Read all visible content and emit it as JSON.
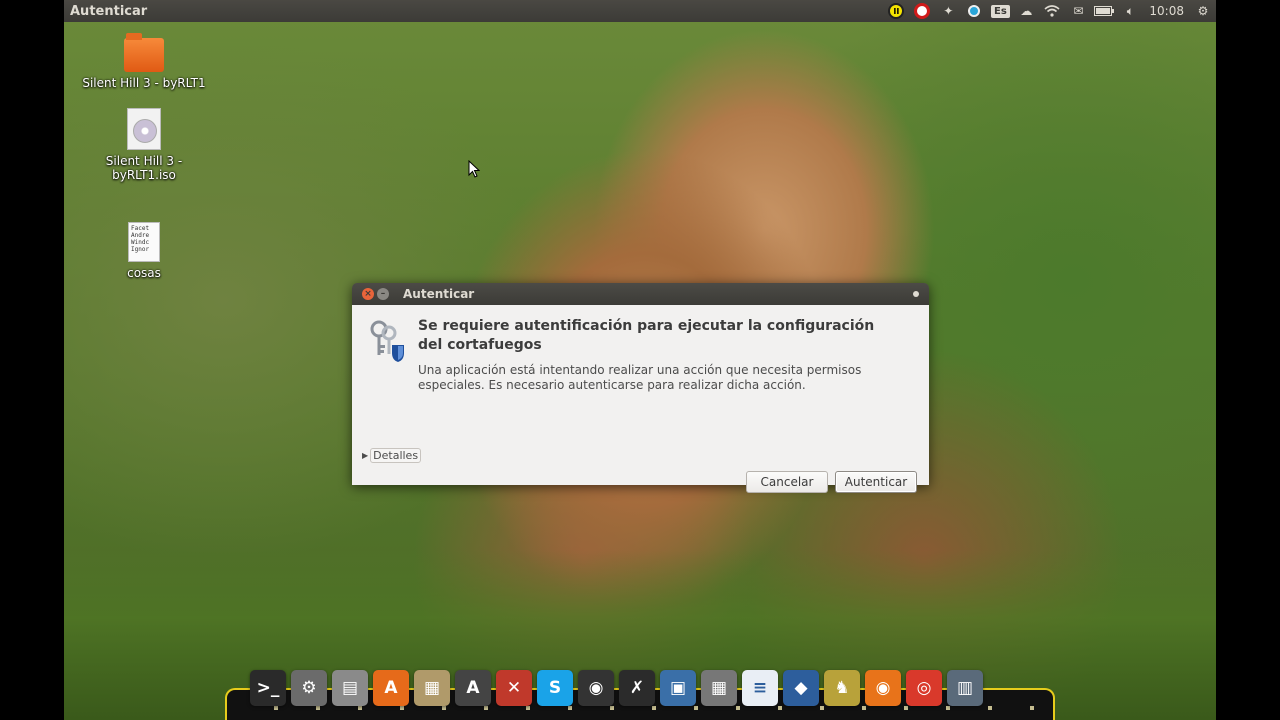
{
  "top_panel": {
    "title": "Autenticar",
    "keyboard_layout": "Es",
    "clock": "10:08",
    "indicators": [
      "indicator-1-icon",
      "indicator-2-icon",
      "dropbox-icon",
      "update-icon",
      "keyboard-icon",
      "cloud-icon",
      "wifi-icon",
      "mail-icon",
      "battery-icon",
      "volume-icon",
      "clock",
      "settings-gear-icon"
    ]
  },
  "desktop_icons": [
    {
      "label": "Silent Hill 3 - byRLT1",
      "icon": "folder-icon"
    },
    {
      "label": "Silent Hill 3 - byRLT1.iso",
      "icon": "disc-image-icon"
    },
    {
      "label": "cosas",
      "icon": "text-file-icon",
      "preview": "Facet\nAndre\nWindc\nIgnor"
    }
  ],
  "dialog": {
    "title": "Autenticar",
    "heading": "Se requiere autentificación para ejecutar la configuración del cortafuegos",
    "message": "Una aplicación está intentando realizar una acción que necesita permisos especiales. Es necesario autenticarse para realizar dicha acción.",
    "details_label": "Detalles",
    "cancel_label": "Cancelar",
    "auth_label": "Autenticar"
  },
  "dock": {
    "items": [
      {
        "name": "terminal",
        "color": "#2a2a2a",
        "glyph": ">_"
      },
      {
        "name": "ubuntu-tweak",
        "color": "#6b6b6b",
        "glyph": "⚙"
      },
      {
        "name": "files",
        "color": "#8a8a8a",
        "glyph": "▤"
      },
      {
        "name": "software-center",
        "color": "#e66a1a",
        "glyph": "A"
      },
      {
        "name": "archive-manager",
        "color": "#b09a6a",
        "glyph": "▦"
      },
      {
        "name": "update-manager",
        "color": "#444444",
        "glyph": "A"
      },
      {
        "name": "system-tools",
        "color": "#c0392b",
        "glyph": "✕"
      },
      {
        "name": "skype",
        "color": "#1aa3e8",
        "glyph": "S"
      },
      {
        "name": "steam",
        "color": "#333333",
        "glyph": "◉"
      },
      {
        "name": "xbmc",
        "color": "#2b2b2b",
        "glyph": "✗"
      },
      {
        "name": "image-viewer",
        "color": "#3a6fa8",
        "glyph": "▣"
      },
      {
        "name": "calculator",
        "color": "#777777",
        "glyph": "▦"
      },
      {
        "name": "text-editor",
        "color": "#e9eef5",
        "glyph": "≡"
      },
      {
        "name": "virtualbox",
        "color": "#2d5e9c",
        "glyph": "◆"
      },
      {
        "name": "pidgin",
        "color": "#b8a23a",
        "glyph": "♞"
      },
      {
        "name": "firefox",
        "color": "#e8731a",
        "glyph": "◉"
      },
      {
        "name": "chrome",
        "color": "#d9392b",
        "glyph": "◎"
      },
      {
        "name": "trash",
        "color": "#5a6a7a",
        "glyph": "▥"
      }
    ]
  }
}
